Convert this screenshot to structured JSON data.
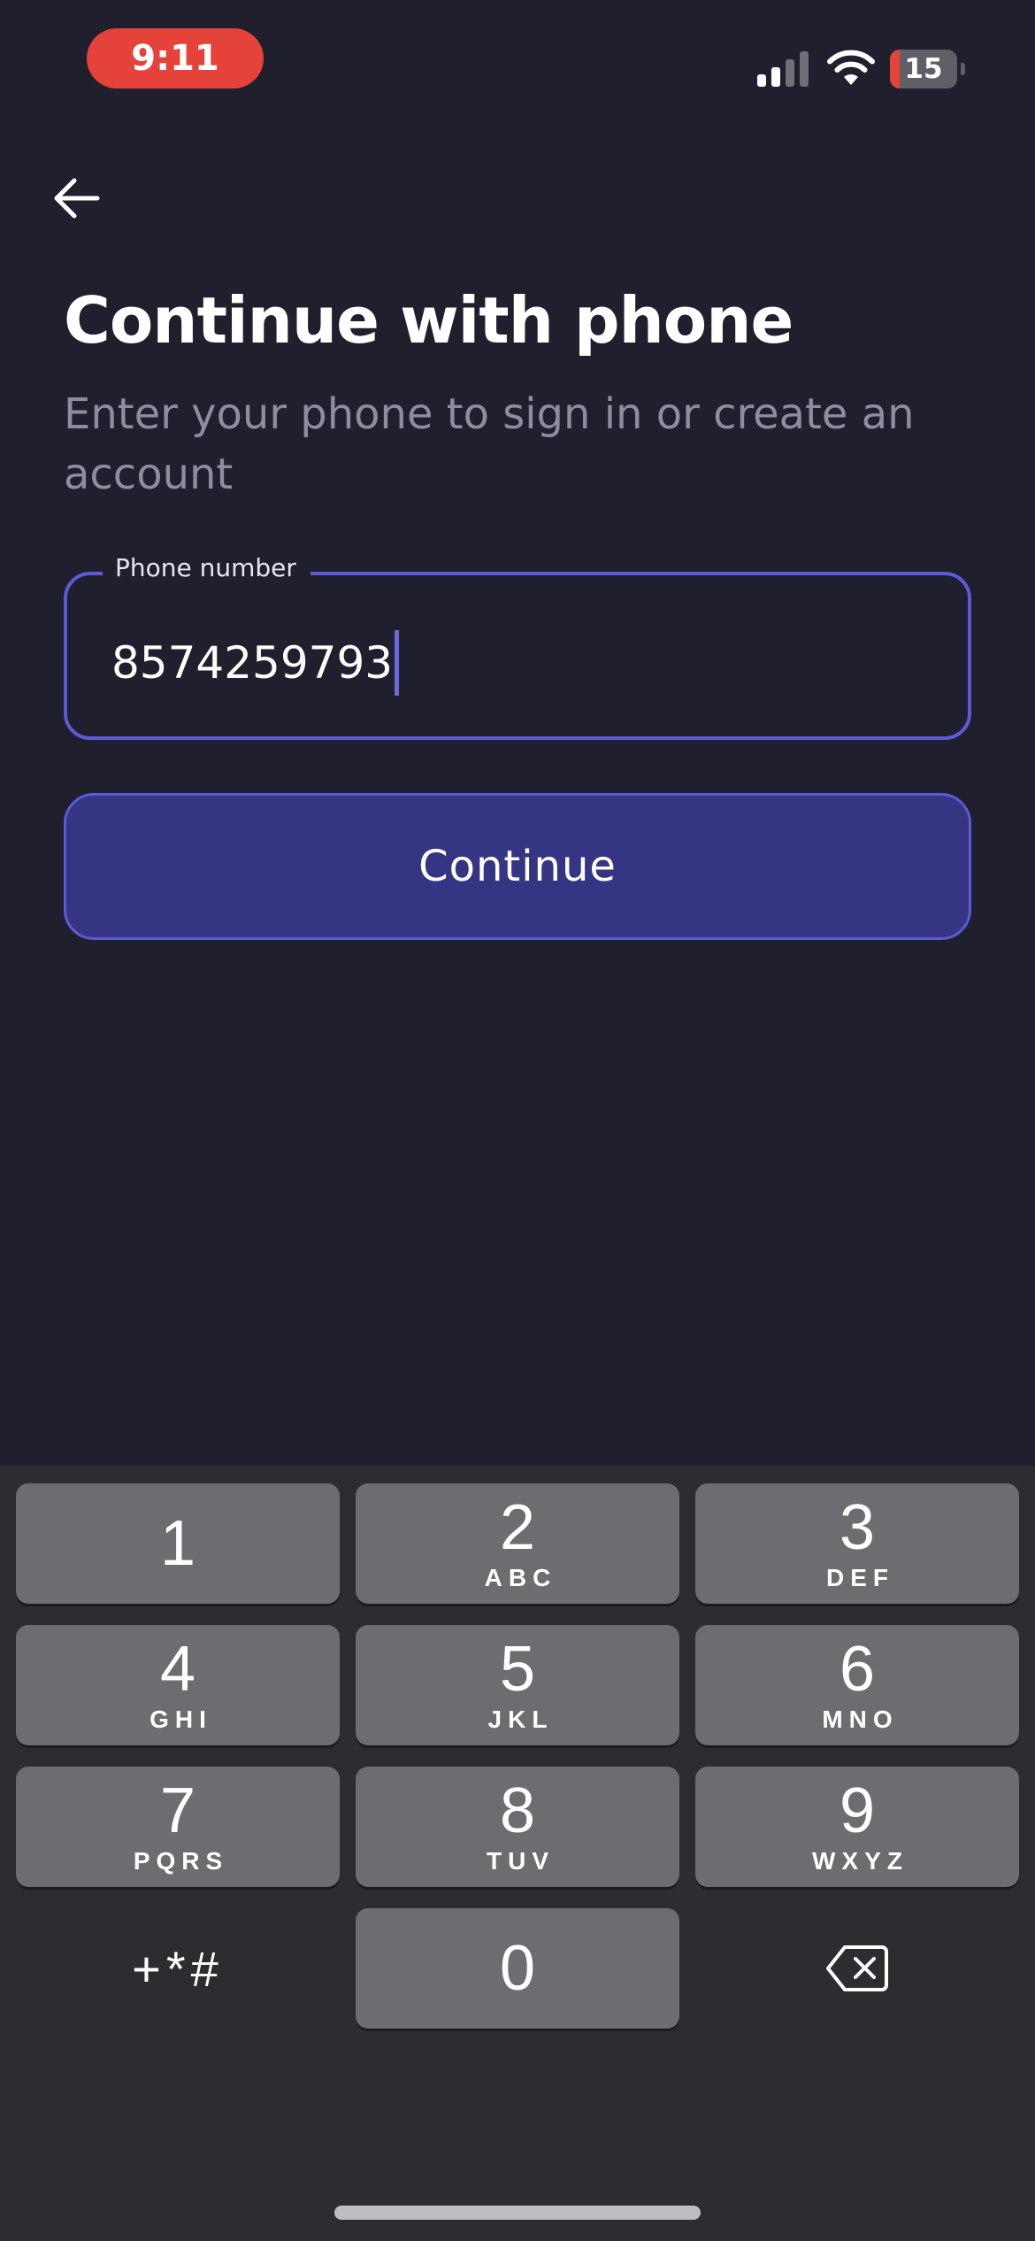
{
  "status_bar": {
    "time": "9:11",
    "battery_level": "15",
    "battery_fraction": 0.15,
    "signal_bars_active": 2,
    "signal_bars_total": 4
  },
  "header": {
    "back_icon": "arrow-left-icon",
    "title": "Continue with phone",
    "subtitle": "Enter your phone to sign in or create an account"
  },
  "form": {
    "phone_label": "Phone number",
    "phone_value": "8574259793",
    "continue_label": "Continue"
  },
  "keypad": {
    "keys": [
      {
        "digit": "1",
        "letters": ""
      },
      {
        "digit": "2",
        "letters": "ABC"
      },
      {
        "digit": "3",
        "letters": "DEF"
      },
      {
        "digit": "4",
        "letters": "GHI"
      },
      {
        "digit": "5",
        "letters": "JKL"
      },
      {
        "digit": "6",
        "letters": "MNO"
      },
      {
        "digit": "7",
        "letters": "PQRS"
      },
      {
        "digit": "8",
        "letters": "TUV"
      },
      {
        "digit": "9",
        "letters": "WXYZ"
      },
      {
        "digit": "0",
        "letters": ""
      }
    ],
    "symbols_label": "+*#",
    "delete_icon": "backspace-icon"
  },
  "colors": {
    "background": "#1f1f2d",
    "accent": "#5b5bd6",
    "button_fill": "#363583",
    "subtitle": "#8e8d9d",
    "status_time_pill": "#e5423a",
    "keyboard_bg": "#2d2d31",
    "key_bg": "#6d6d71"
  }
}
